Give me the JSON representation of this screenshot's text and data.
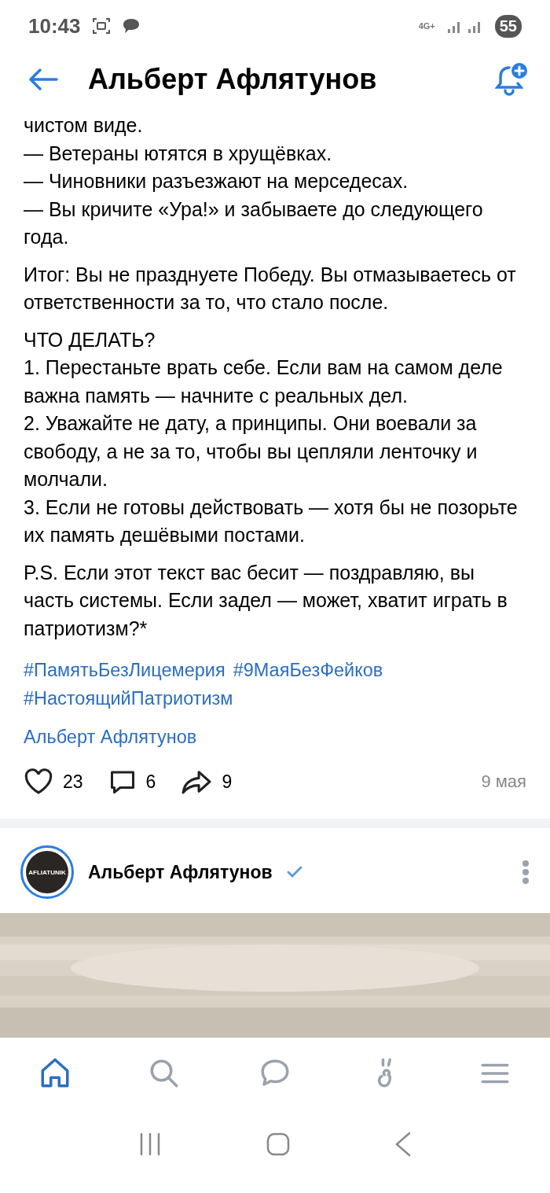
{
  "status_bar": {
    "time": "10:43",
    "network": "4G+",
    "battery": "55"
  },
  "header": {
    "title": "Альберт Афлятунов"
  },
  "post": {
    "paragraphs": [
      [
        "чистом виде.",
        "— Ветераны ютятся в хрущёвках.",
        "— Чиновники разъезжают на мерседесах.",
        "— Вы кричите «Ура!» и забываете до следующего года."
      ],
      [
        "Итог: Вы не празднуете Победу. Вы отмазываетесь от ответственности за то, что стало после."
      ],
      [
        "ЧТО ДЕЛАТЬ?",
        "1. Перестаньте врать себе. Если вам на самом деле важна память — начните с реальных дел.",
        "2. Уважайте не дату, а принципы. Они воевали за свободу, а не за то, чтобы вы цепляли ленточку и молчали.",
        "3. Если не готовы действовать — хотя бы не позорьте их память дешёвыми постами."
      ],
      [
        "P.S. Если этот текст вас бесит — поздравляю, вы часть системы. Если задел — может, хватит играть в патриотизм?*"
      ]
    ],
    "hashtags": [
      "#ПамятьБезЛицемерия",
      "#9МаяБезФейков",
      "#НастоящийПатриотизм"
    ],
    "author": "Альберт Афлятунов",
    "likes": "23",
    "comments": "6",
    "reposts": "9",
    "date": "9 мая"
  },
  "next_post": {
    "author": "Альберт Афлятунов",
    "verified": true,
    "avatar_text": "AFLIATUNIK"
  },
  "nav": [
    {
      "kind": "home",
      "selected": true
    },
    {
      "kind": "search",
      "selected": false
    },
    {
      "kind": "messages",
      "selected": false
    },
    {
      "kind": "clips",
      "selected": false
    },
    {
      "kind": "menu",
      "selected": false
    }
  ]
}
